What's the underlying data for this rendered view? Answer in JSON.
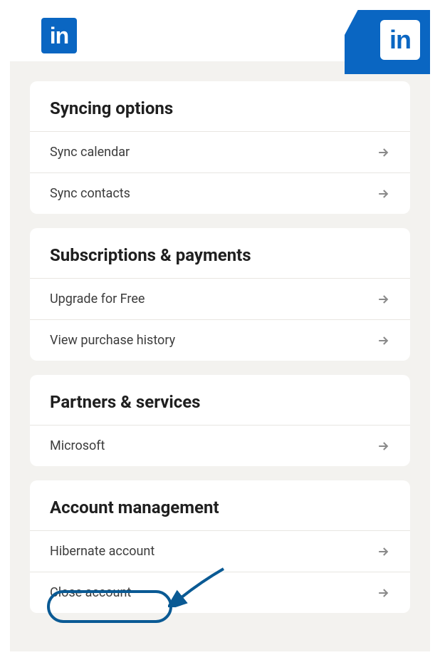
{
  "brand": {
    "name": "LinkedIn",
    "logo_text": "in",
    "primary_color": "#0a66c2",
    "highlight_color": "#0a5a94"
  },
  "sections": [
    {
      "title": "Syncing options",
      "items": [
        {
          "label": "Sync calendar"
        },
        {
          "label": "Sync contacts"
        }
      ]
    },
    {
      "title": "Subscriptions & payments",
      "items": [
        {
          "label": "Upgrade for Free"
        },
        {
          "label": "View purchase history"
        }
      ]
    },
    {
      "title": "Partners & services",
      "items": [
        {
          "label": "Microsoft"
        }
      ]
    },
    {
      "title": "Account management",
      "items": [
        {
          "label": "Hibernate account"
        },
        {
          "label": "Close account"
        }
      ]
    }
  ]
}
